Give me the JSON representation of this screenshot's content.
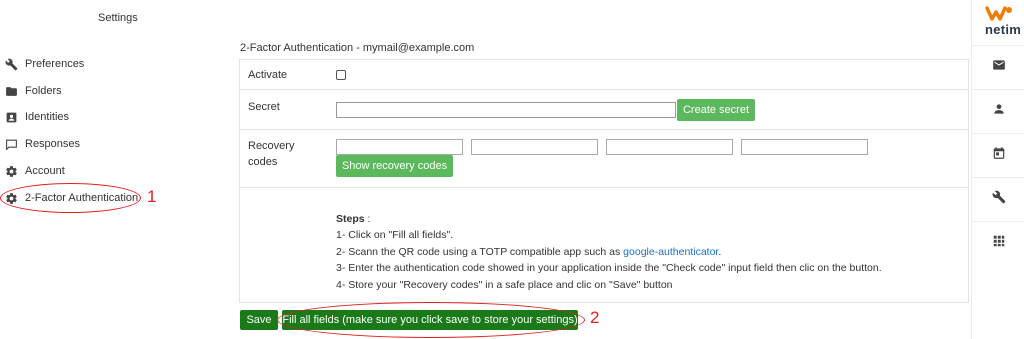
{
  "header": {
    "title": "Settings"
  },
  "sidebar": {
    "items": [
      {
        "label": "Preferences",
        "icon": "wrench-icon"
      },
      {
        "label": "Folders",
        "icon": "folder-icon"
      },
      {
        "label": "Identities",
        "icon": "identity-card-icon"
      },
      {
        "label": "Responses",
        "icon": "chat-bubble-icon"
      },
      {
        "label": "Account",
        "icon": "gear-icon"
      },
      {
        "label": "2-Factor Authentication",
        "icon": "gear-icon"
      }
    ]
  },
  "annotations": {
    "marker1": "1",
    "marker2": "2",
    "color": "#e02020"
  },
  "form": {
    "title": "2-Factor Authentication - mymail@example.com",
    "activate_label": "Activate",
    "activate_checked": false,
    "secret_label": "Secret",
    "secret_value": "",
    "create_secret_label": "Create secret",
    "recovery_label_line1": "Recovery",
    "recovery_label_line2": "codes",
    "recovery_codes": [
      "",
      "",
      "",
      ""
    ],
    "show_recovery_label": "Show recovery codes",
    "steps": {
      "heading": "Steps",
      "heading_suffix": " :",
      "step1": "1- Click on \"Fill all fields\".",
      "step2_prefix": "2- Scann the QR code using a TOTP compatible app such as ",
      "step2_link": "google-authenticator",
      "step2_suffix": ".",
      "step3": "3- Enter the authentication code showed in your application inside the \"Check code\" input field then clic on the button.",
      "step4": "4- Store your \"Recovery codes\" in a safe place and clic on \"Save\" button"
    },
    "save_label": "Save",
    "fill_all_label": "Fill all fields (make sure you click save to store your settings)"
  },
  "brand": {
    "name": "netim",
    "accent": "#f07d00"
  },
  "right_bar": {
    "icons": [
      "mail-icon",
      "contacts-icon",
      "calendar-icon",
      "wrench-icon",
      "apps-grid-icon"
    ]
  },
  "colors": {
    "button_light": "#5cb85c",
    "button_dark": "#1a7a1a",
    "link": "#1f6fc5"
  }
}
